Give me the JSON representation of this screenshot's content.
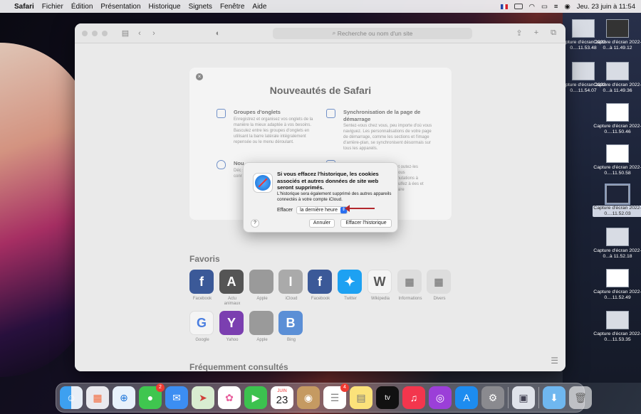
{
  "menubar": {
    "app": "Safari",
    "items": [
      "Fichier",
      "Édition",
      "Présentation",
      "Historique",
      "Signets",
      "Fenêtre",
      "Aide"
    ],
    "clock": "Jeu. 23 juin à 11:54"
  },
  "safari": {
    "search_placeholder": "Recherche ou nom d'un site",
    "whats_new": {
      "title": "Nouveautés de Safari",
      "features": [
        {
          "title": "Groupes d'onglets",
          "body": "Enregistrez et organisez vos onglets de la manière la mieux adaptée à vos besoins. Basculez entre les groupes d'onglets en utilisant la barre latérale intégralement repensée ou le menu déroulant."
        },
        {
          "title": "Synchronisation de la page de démarrage",
          "body": "Sentez-vous chez vous, peu importe d'où vous naviguez. Les personnalisations de votre page de démarrage, comme les sections et l'image d'arrière-plan, se synchronisent désormais sur tous les appareils."
        },
        {
          "title": "Nou",
          "body": "Déc sur conr"
        },
        {
          "title": "",
          "body": "et outez-les vous mutations à sulfez à ées et faire"
        }
      ]
    },
    "favorites_title": "Favoris",
    "favorites": [
      {
        "label": "Facebook",
        "glyph": "f",
        "color": "#3b5998"
      },
      {
        "label": "Actu animaux",
        "glyph": "A",
        "color": "#555"
      },
      {
        "label": "Apple",
        "glyph": "",
        "color": "#9a9a9a"
      },
      {
        "label": "iCloud",
        "glyph": "I",
        "color": "#aaa"
      },
      {
        "label": "Facebook",
        "glyph": "f",
        "color": "#3b5998"
      },
      {
        "label": "Twitter",
        "glyph": "t",
        "color": "#1da1f2"
      },
      {
        "label": "Wikipedia",
        "glyph": "W",
        "color": "#f4f4f4"
      },
      {
        "label": "Informations",
        "glyph": "▦",
        "color": "#ddd"
      },
      {
        "label": "Divers",
        "glyph": "▦",
        "color": "#ddd"
      },
      {
        "label": "Google",
        "glyph": "G",
        "color": "#f4f4f4"
      },
      {
        "label": "Yahoo",
        "glyph": "Y",
        "color": "#7b3fb0"
      },
      {
        "label": "Apple",
        "glyph": "",
        "color": "#9a9a9a"
      },
      {
        "label": "Bing",
        "glyph": "B",
        "color": "#5b8fd6"
      }
    ],
    "frequent_title": "Fréquemment consultés"
  },
  "dialog": {
    "title": "Si vous effacez l'historique, les cookies associés et autres données de site web seront supprimés.",
    "message": "L'historique sera également supprimé des autres appareils connectés à votre compte iCloud.",
    "clear_label": "Effacer",
    "range_value": "la dernière heure",
    "help": "?",
    "cancel": "Annuler",
    "confirm": "Effacer l'historique"
  },
  "desktop": [
    {
      "label": "Capture d'écran 2022-0....11.53.48"
    },
    {
      "label": "Capture d'écran 2022-0...à 11.49.12"
    },
    {
      "label": "Capture d'écran 2022-0....11.54.07"
    },
    {
      "label": "Capture d'écran 2022-0...à 11.49.36"
    },
    {
      "label": "Capture d'écran 2022-0....11.50.46"
    },
    {
      "label": "Capture d'écran 2022-0....11.50.58"
    },
    {
      "label": "Capture d'écran 2022-0....11.52.03"
    },
    {
      "label": "Capture d'écran 2022-0...à 11.52.18"
    },
    {
      "label": "Capture d'écran 2022-0....11.52.49"
    },
    {
      "label": "Capture d'écran 2022-0....11.53.35"
    }
  ],
  "dock": {
    "calendar_month": "JUIN",
    "calendar_day": "23",
    "messages_badge": "2",
    "reminders_badge": "4",
    "tv_label": "tv"
  }
}
